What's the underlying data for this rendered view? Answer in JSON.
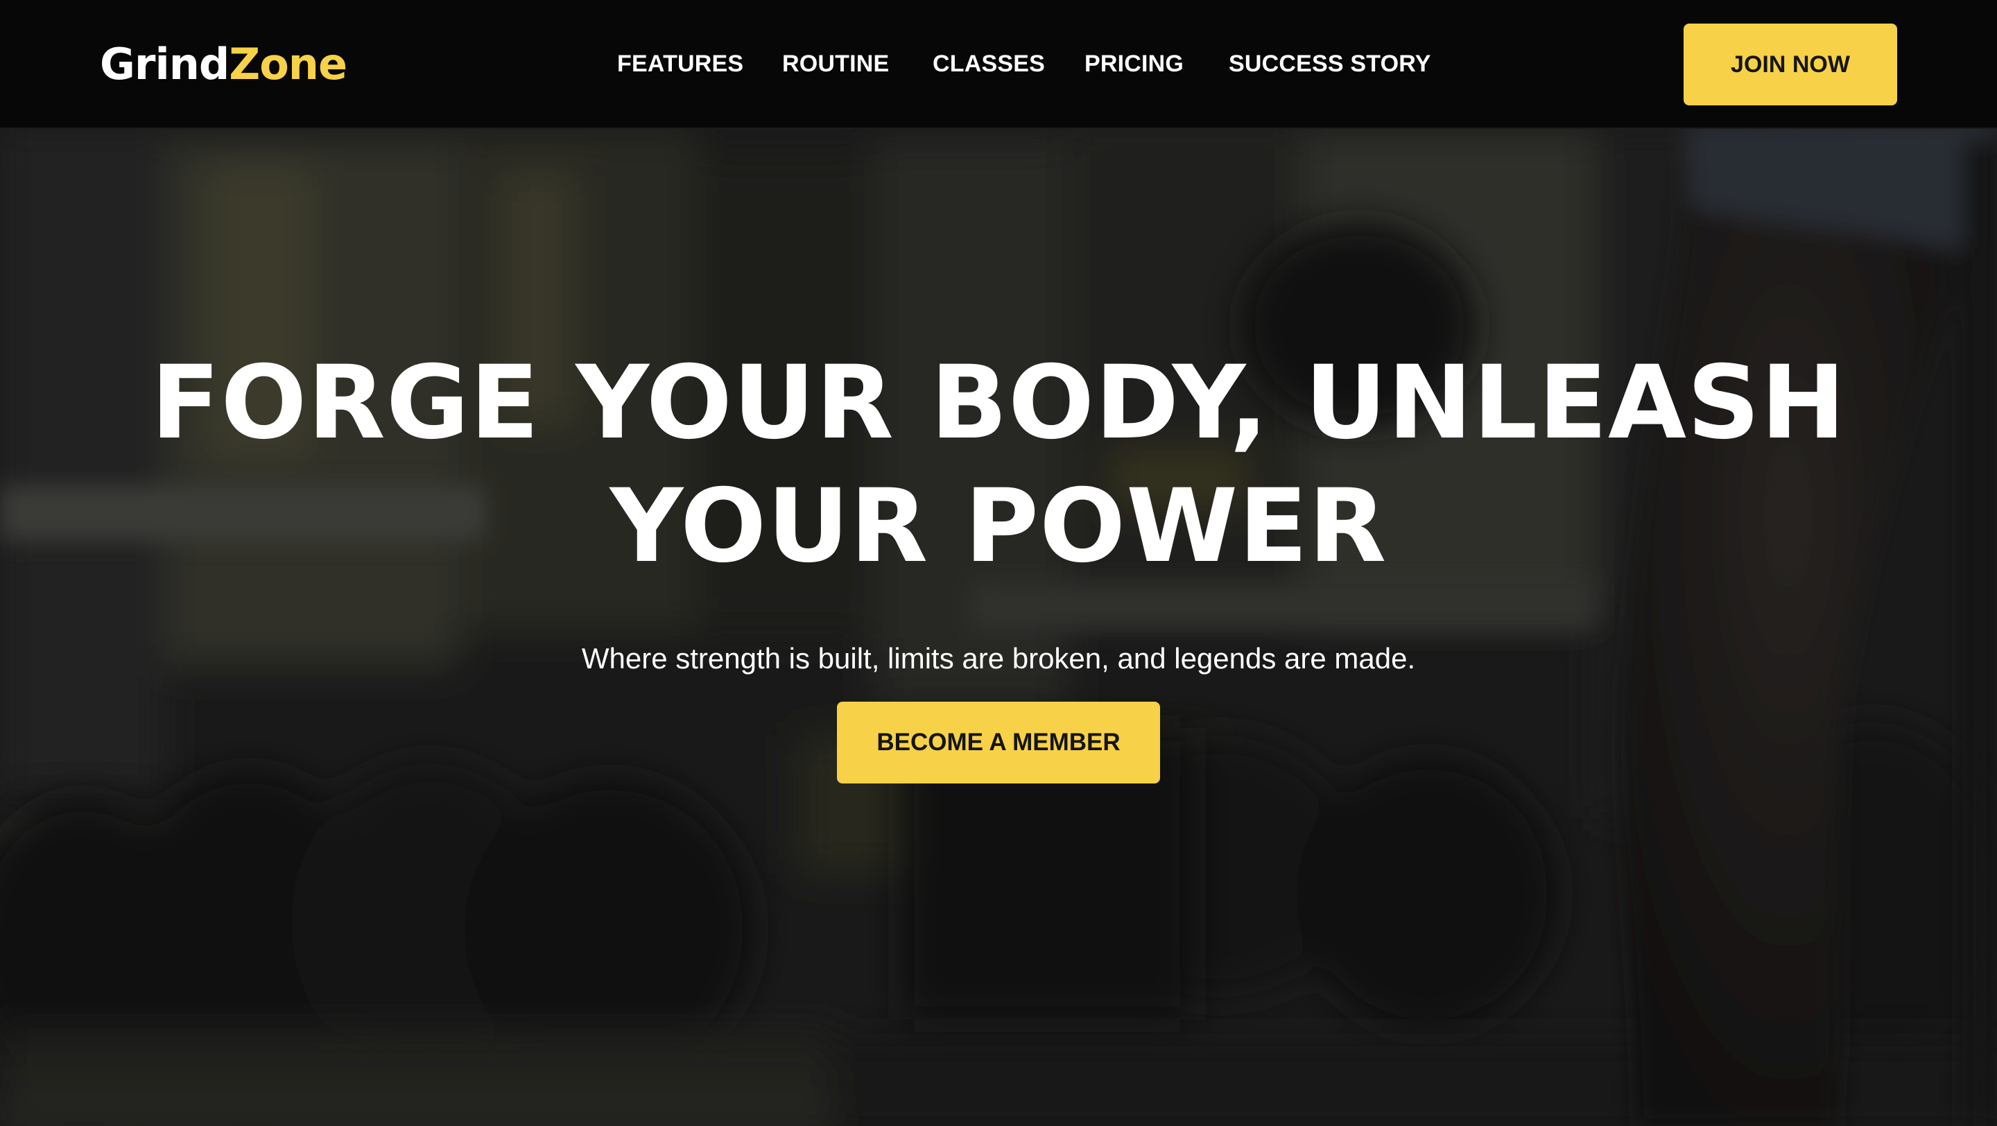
{
  "brand": {
    "name_part_1": "Grind",
    "name_part_2": "Zone",
    "accent_color": "#f7d147"
  },
  "nav": {
    "links": [
      {
        "label": "FEATURES"
      },
      {
        "label": "ROUTINE"
      },
      {
        "label": "CLASSES"
      },
      {
        "label": "PRICING"
      },
      {
        "label": "SUCCESS STORY"
      }
    ],
    "cta_label": "JOIN NOW"
  },
  "hero": {
    "title_line_1": "FORGE YOUR BODY, UNLEASH",
    "title_line_2": "YOUR POWER",
    "subtitle": "Where strength is built, limits are broken, and legends are made.",
    "cta_label": "BECOME A MEMBER"
  },
  "colors": {
    "nav_background": "#070707",
    "button_background": "#f7d147",
    "button_text": "#151515",
    "text_primary": "#ffffff"
  }
}
